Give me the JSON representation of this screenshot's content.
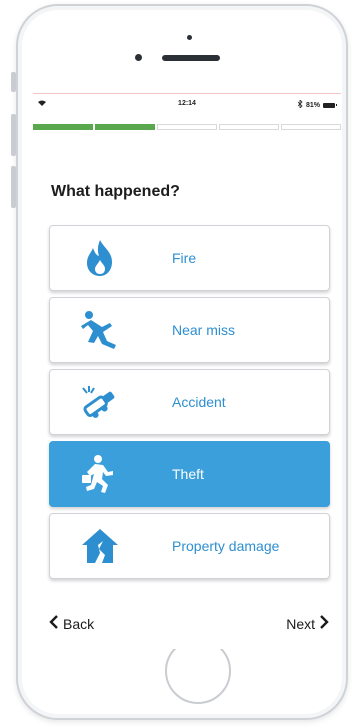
{
  "status_bar": {
    "time": "12:14",
    "battery": "81%"
  },
  "progress": {
    "total_steps": 5,
    "completed_steps": 2
  },
  "screen": {
    "title": "What happened?"
  },
  "options": [
    {
      "label": "Fire",
      "icon": "fire-icon",
      "selected": false
    },
    {
      "label": "Near miss",
      "icon": "near-miss-icon",
      "selected": false
    },
    {
      "label": "Accident",
      "icon": "accident-icon",
      "selected": false
    },
    {
      "label": "Theft",
      "icon": "theft-icon",
      "selected": true
    },
    {
      "label": "Property damage",
      "icon": "property-damage-icon",
      "selected": false
    }
  ],
  "nav": {
    "back_label": "Back",
    "next_label": "Next"
  },
  "colors": {
    "accent": "#3b9fdc",
    "progress_done": "#5aa84e",
    "label_text": "#2e8fd0",
    "icon": "#2e8fd0"
  }
}
